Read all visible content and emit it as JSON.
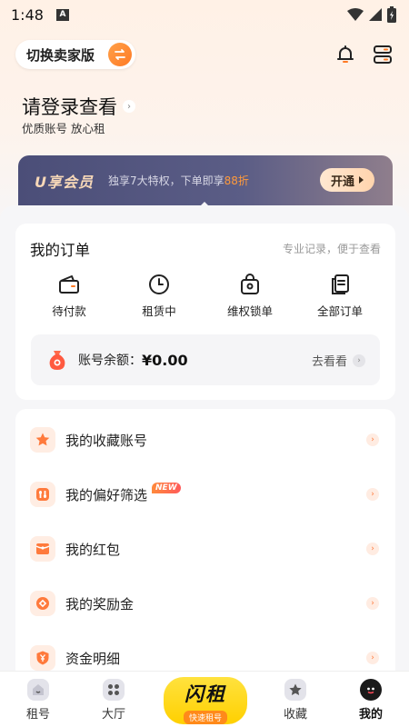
{
  "status_bar": {
    "time": "1:48",
    "badge": "A"
  },
  "header": {
    "switch_label": "切换卖家版"
  },
  "login": {
    "title": "请登录查看",
    "subtitle": "优质账号 放心租"
  },
  "vip": {
    "name": "U享会员",
    "desc_prefix": "独享7大特权，下单即享",
    "desc_highlight": "88折",
    "button_label": "开通"
  },
  "orders": {
    "title": "我的订单",
    "subtitle": "专业记录，便于查看",
    "items": [
      {
        "label": "待付款",
        "icon": "wallet-icon"
      },
      {
        "label": "租赁中",
        "icon": "clock-icon"
      },
      {
        "label": "维权锁单",
        "icon": "lock-bag-icon"
      },
      {
        "label": "全部订单",
        "icon": "document-icon"
      }
    ],
    "balance_label": "账号余额：",
    "balance_value": "¥0.00",
    "balance_link": "去看看"
  },
  "menu": {
    "items": [
      {
        "label": "我的收藏账号",
        "icon": "star-icon"
      },
      {
        "label": "我的偏好筛选",
        "icon": "filter-icon",
        "badge": "NEW"
      },
      {
        "label": "我的红包",
        "icon": "red-packet-icon"
      },
      {
        "label": "我的奖励金",
        "icon": "coin-icon"
      },
      {
        "label": "资金明细",
        "icon": "shield-yen-icon"
      }
    ]
  },
  "tabbar": {
    "tabs": [
      {
        "label": "租号",
        "icon": "home-icon"
      },
      {
        "label": "大厅",
        "icon": "grid-icon"
      },
      {
        "label": "收藏",
        "icon": "star-icon"
      },
      {
        "label": "我的",
        "icon": "face-icon"
      }
    ],
    "center_main": "闪租",
    "center_sub": "快速租号"
  },
  "colors": {
    "accent": "#ff7a24",
    "vip_bg": "#4b4e78",
    "center_tab": "#ffd000"
  }
}
